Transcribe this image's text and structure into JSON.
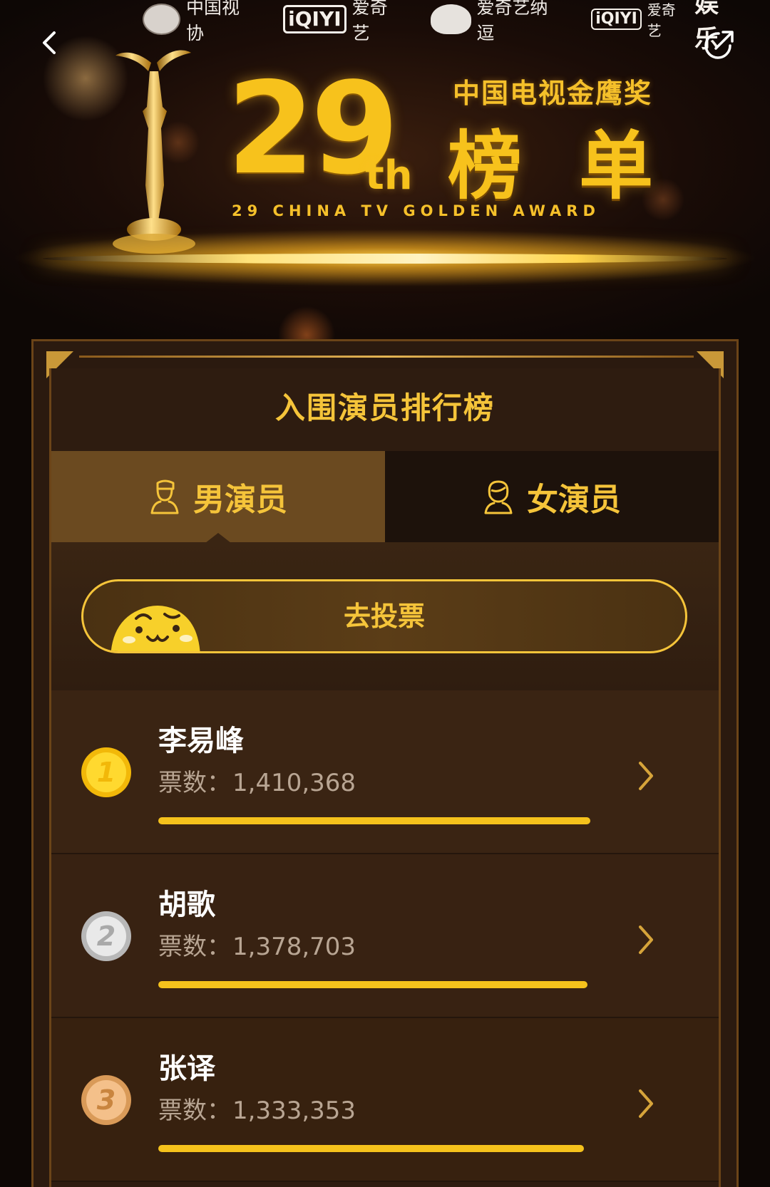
{
  "header": {
    "logos": [
      {
        "name": "cctva-logo",
        "label": "中国视协"
      },
      {
        "name": "iqiyi-logo",
        "mark": "iQIYI",
        "label": "爱奇艺"
      },
      {
        "name": "iqiyi-nadou-logo",
        "label": "爱奇艺纳逗"
      },
      {
        "name": "iqiyi-yule-logo",
        "mark": "iQIYI",
        "label": "爱奇艺",
        "label_big": "娱乐"
      }
    ]
  },
  "banner": {
    "number": "29",
    "suffix": "th",
    "award_name": "中国电视金鹰奖",
    "award_title": "榜单",
    "award_subtitle": "29 CHINA TV GOLDEN AWARD"
  },
  "panel": {
    "title": "入围演员排行榜",
    "tabs": [
      {
        "label": "男演员",
        "active": true
      },
      {
        "label": "女演员",
        "active": false
      }
    ],
    "vote_button": "去投票"
  },
  "ranking": {
    "vote_label": "票数：",
    "items": [
      {
        "rank": "1",
        "name": "李易峰",
        "votes": "1,410,368",
        "vote_value": 1410368,
        "medal": "gold"
      },
      {
        "rank": "2",
        "name": "胡歌",
        "votes": "1,378,703",
        "vote_value": 1378703,
        "medal": "silver"
      },
      {
        "rank": "3",
        "name": "张译",
        "votes": "1,333,353",
        "vote_value": 1333353,
        "medal": "bronze"
      }
    ]
  },
  "colors": {
    "gold": "#f5c43a",
    "bar": "#f5c21c",
    "panel_bg": "#2e1c10",
    "tab_active": "#6b4a20",
    "tab_inactive": "#1d120b"
  }
}
